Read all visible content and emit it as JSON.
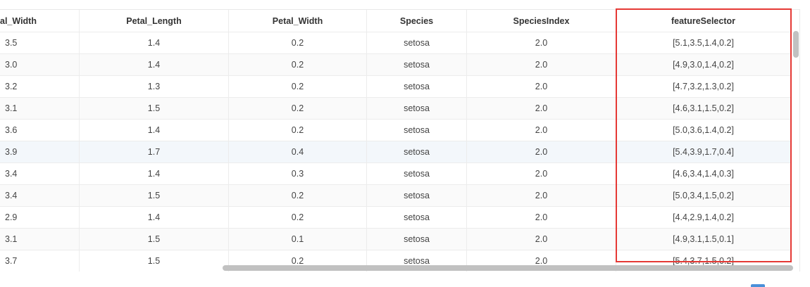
{
  "table": {
    "columns": [
      "al_Width",
      "Petal_Length",
      "Petal_Width",
      "Species",
      "SpeciesIndex",
      "featureSelector"
    ],
    "rows": [
      [
        "3.5",
        "1.4",
        "0.2",
        "setosa",
        "2.0",
        "[5.1,3.5,1.4,0.2]"
      ],
      [
        "3.0",
        "1.4",
        "0.2",
        "setosa",
        "2.0",
        "[4.9,3.0,1.4,0.2]"
      ],
      [
        "3.2",
        "1.3",
        "0.2",
        "setosa",
        "2.0",
        "[4.7,3.2,1.3,0.2]"
      ],
      [
        "3.1",
        "1.5",
        "0.2",
        "setosa",
        "2.0",
        "[4.6,3.1,1.5,0.2]"
      ],
      [
        "3.6",
        "1.4",
        "0.2",
        "setosa",
        "2.0",
        "[5.0,3.6,1.4,0.2]"
      ],
      [
        "3.9",
        "1.7",
        "0.4",
        "setosa",
        "2.0",
        "[5.4,3.9,1.7,0.4]"
      ],
      [
        "3.4",
        "1.4",
        "0.3",
        "setosa",
        "2.0",
        "[4.6,3.4,1.4,0.3]"
      ],
      [
        "3.4",
        "1.5",
        "0.2",
        "setosa",
        "2.0",
        "[5.0,3.4,1.5,0.2]"
      ],
      [
        "2.9",
        "1.4",
        "0.2",
        "setosa",
        "2.0",
        "[4.4,2.9,1.4,0.2]"
      ],
      [
        "3.1",
        "1.5",
        "0.1",
        "setosa",
        "2.0",
        "[4.9,3.1,1.5,0.1]"
      ],
      [
        "3.7",
        "1.5",
        "0.2",
        "setosa",
        "2.0",
        "[5.4,3.7,1.5,0.2]"
      ]
    ],
    "highlighted_column": "featureSelector",
    "hovered_row": 5
  },
  "colors": {
    "highlight_border": "#e53935",
    "scrollbar_thumb": "#c1c1c1",
    "hover_row": "#f3f7fb"
  }
}
